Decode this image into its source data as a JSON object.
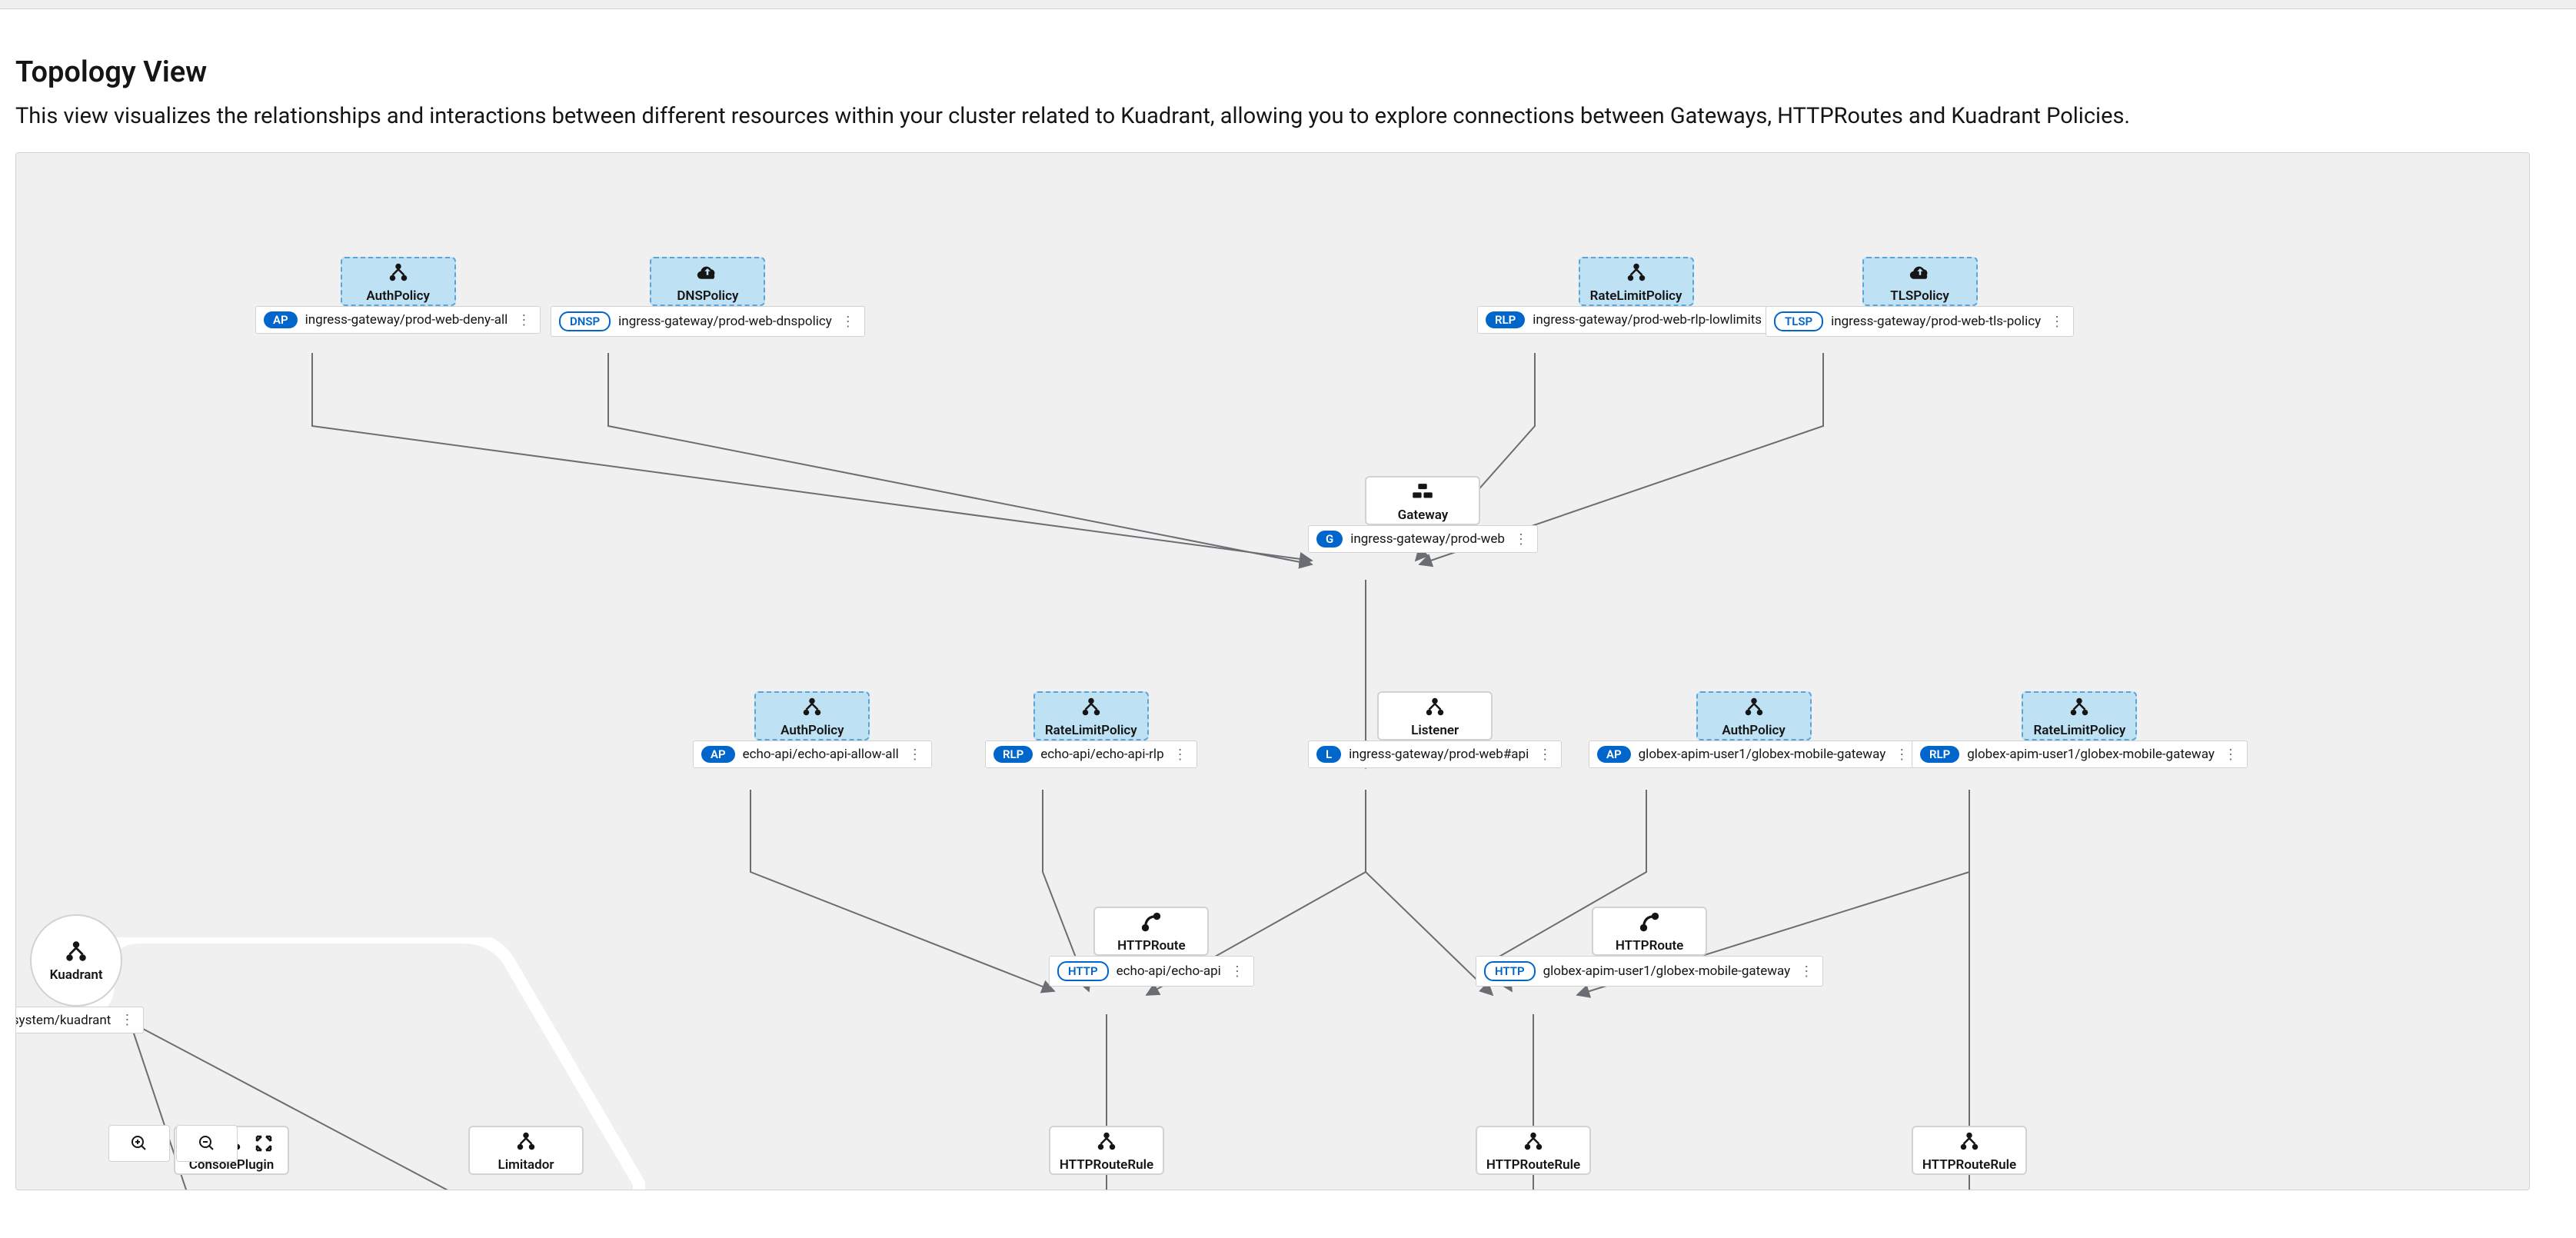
{
  "page": {
    "title": "Topology View",
    "description": "This view visualizes the relationships and interactions between different resources within your cluster related to Kuadrant, allowing you to explore connections between Gateways, HTTPRoutes and Kuadrant Policies."
  },
  "nodes": {
    "authpolicy1": {
      "type": "AuthPolicy",
      "badge": "AP",
      "label": "ingress-gateway/prod-web-deny-all"
    },
    "dnspolicy": {
      "type": "DNSPolicy",
      "badge": "DNSP",
      "badgeStyle": "outline",
      "label": "ingress-gateway/prod-web-dnspolicy"
    },
    "ratelimit1": {
      "type": "RateLimitPolicy",
      "badge": "RLP",
      "label": "ingress-gateway/prod-web-rlp-lowlimits"
    },
    "tlspolicy": {
      "type": "TLSPolicy",
      "badge": "TLSP",
      "badgeStyle": "outline",
      "label": "ingress-gateway/prod-web-tls-policy"
    },
    "gateway": {
      "type": "Gateway",
      "badge": "G",
      "label": "ingress-gateway/prod-web"
    },
    "authpolicy2": {
      "type": "AuthPolicy",
      "badge": "AP",
      "label": "echo-api/echo-api-allow-all"
    },
    "ratelimit2": {
      "type": "RateLimitPolicy",
      "badge": "RLP",
      "label": "echo-api/echo-api-rlp"
    },
    "listener": {
      "type": "Listener",
      "badge": "L",
      "label": "ingress-gateway/prod-web#api"
    },
    "authpolicy3": {
      "type": "AuthPolicy",
      "badge": "AP",
      "label": "globex-apim-user1/globex-mobile-gateway"
    },
    "ratelimit3": {
      "type": "RateLimitPolicy",
      "badge": "RLP",
      "label": "globex-apim-user1/globex-mobile-gateway"
    },
    "httproute1": {
      "type": "HTTPRoute",
      "badge": "HTTP",
      "badgeStyle": "outline",
      "label": "echo-api/echo-api"
    },
    "httproute2": {
      "type": "HTTPRoute",
      "badge": "HTTP",
      "badgeStyle": "outline",
      "label": "globex-apim-user1/globex-mobile-gateway"
    },
    "kuadrant": {
      "type": "Kuadrant",
      "label": "int-system/kuadrant"
    },
    "consoleplugin": {
      "type": "ConsolePlugin"
    },
    "limitador": {
      "type": "Limitador"
    },
    "httprouterule1": {
      "type": "HTTPRouteRule"
    },
    "httprouterule2": {
      "type": "HTTPRouteRule"
    },
    "httprouterule3": {
      "type": "HTTPRouteRule"
    }
  },
  "controls": {
    "zoomIn": "zoom-in",
    "zoomOut": "zoom-out",
    "fit": "fit"
  }
}
